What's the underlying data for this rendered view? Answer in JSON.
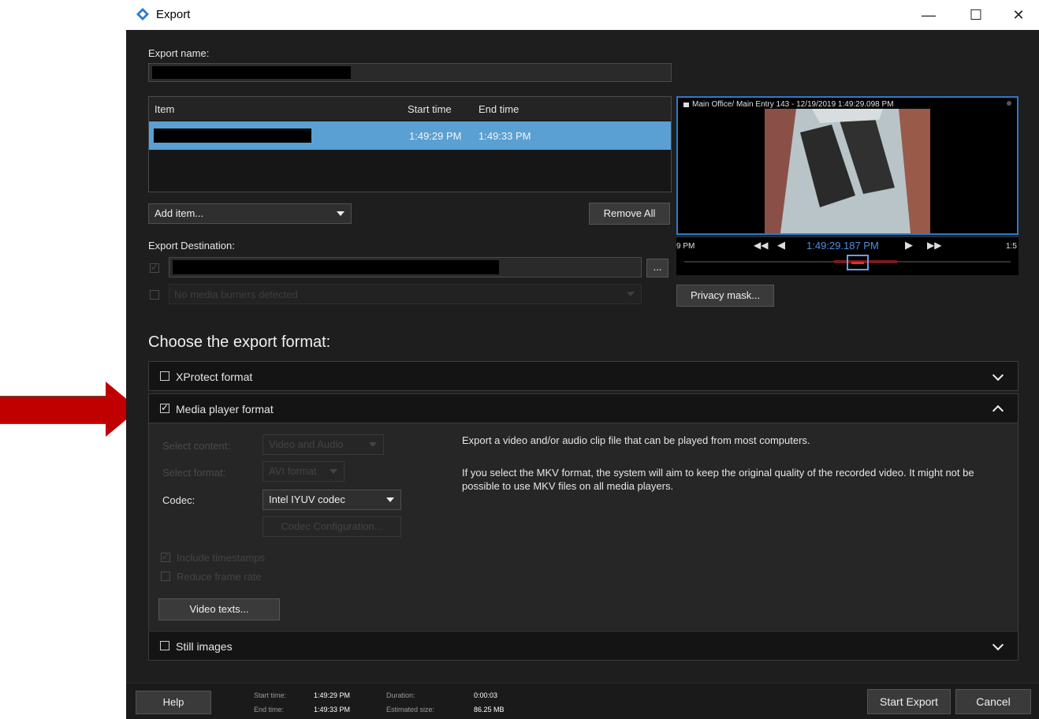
{
  "window": {
    "title": "Export",
    "controls": {
      "minimize": "—",
      "maximize": "☐",
      "close": "✕"
    }
  },
  "export_name": {
    "label": "Export name:"
  },
  "items_table": {
    "columns": [
      "Item",
      "Start time",
      "End time"
    ],
    "rows": [
      {
        "start": "1:49:29 PM",
        "end": "1:49:33 PM"
      }
    ]
  },
  "add_item": {
    "label": "Add item..."
  },
  "remove_all": {
    "label": "Remove All"
  },
  "export_destination": {
    "label": "Export Destination:",
    "browse_label": "...",
    "media_burner_text": "No media burners detected"
  },
  "preview": {
    "camera_title": "Main Office/ Main Entry 143 - 12/19/2019 1:49:29.098 PM",
    "timeline_left": "9 PM",
    "timeline_time": "1:49:29.187 PM",
    "timeline_right": "1:5"
  },
  "privacy_mask": {
    "label": "Privacy mask..."
  },
  "format_heading": "Choose the export format:",
  "formats": {
    "xprotect": {
      "label": "XProtect format",
      "checked": false
    },
    "media_player": {
      "label": "Media player format",
      "checked": true
    },
    "still_images": {
      "label": "Still images",
      "checked": false
    }
  },
  "media_player_panel": {
    "select_content_label": "Select content:",
    "select_content_value": "Video and Audio",
    "select_format_label": "Select format:",
    "select_format_value": "AVI format",
    "codec_label": "Codec:",
    "codec_value": "Intel IYUV codec",
    "codec_config_label": "Codec Configuration...",
    "include_timestamps": "Include timestamps",
    "reduce_frame_rate": "Reduce frame rate",
    "video_texts_label": "Video texts...",
    "description_1": "Export a video and/or audio clip file that can be played from most computers.",
    "description_2": "If you select the MKV format, the system will aim to keep the original quality of the recorded video. It might not be possible to use MKV files on all media players."
  },
  "footer": {
    "help_label": "Help",
    "start_time_label": "Start time:",
    "start_time_value": "1:49:29 PM",
    "end_time_label": "End time:",
    "end_time_value": "1:49:33 PM",
    "duration_label": "Duration:",
    "duration_value": "0:00:03",
    "estimated_size_label": "Estimated size:",
    "estimated_size_value": "86.25 MB",
    "start_export_label": "Start Export",
    "cancel_label": "Cancel"
  },
  "colors": {
    "window_bg": "#1e1e1e",
    "selection": "#5aa0d2",
    "annotation_arrow": "#c00000",
    "timeline_text": "#4f8fe0"
  }
}
